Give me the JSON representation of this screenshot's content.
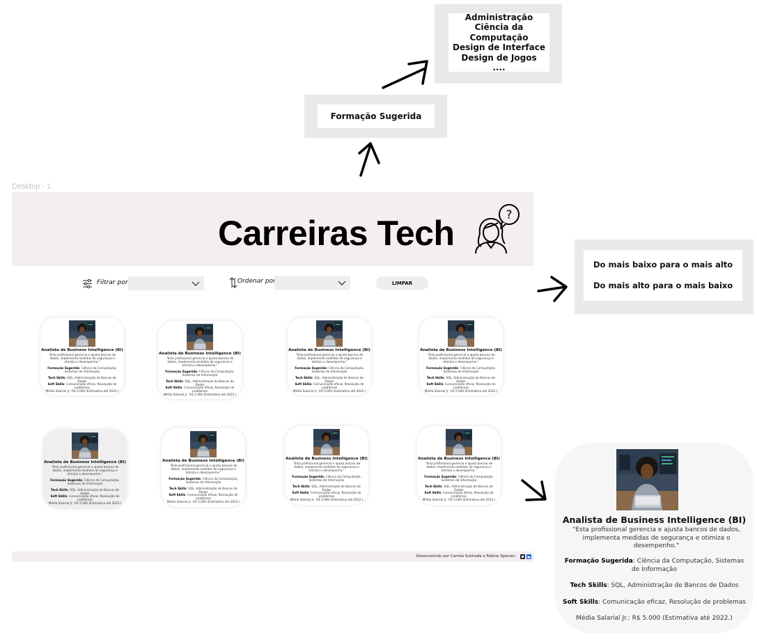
{
  "annotations": {
    "courses_lines": [
      "Administração",
      "Ciência da Computação",
      "Design de Interface",
      "Design de Jogos",
      "...."
    ],
    "formacao_label": "Formação Sugerida",
    "order_options": [
      "Do mais baixo para o mais alto",
      "Do mais alto para o mais baixo"
    ]
  },
  "frame_label": "Desktop - 1",
  "header": {
    "title": "Carreiras Tech"
  },
  "toolbar": {
    "filter_label": "Filtrar por:",
    "filter_value": "",
    "order_label": "Ordenar por:",
    "order_value": "",
    "clear_label": "LIMPAR"
  },
  "card_template": {
    "title": "Analista de Business Intelligence (BI)",
    "description": "\"Esta profissional gerencia e ajusta bancos de dados, implementa medidas de segurança e otimiza o desempenho.\"",
    "formacao_key": "Formação Sugerida",
    "formacao_value": "Ciência da Computação, Sistemas de Informação",
    "tech_key": "Tech Skills",
    "tech_value": "SQL, Administração de Bancos de Dados",
    "soft_key": "Soft Skills",
    "soft_value": "Comunicação eficaz, Resolução de problemas",
    "salary": "Média Salarial Jr.: R$ 5.000 (Estimativa até 2022.)"
  },
  "footer": {
    "text": "Desenvolvido por Camila Sukhada e Fabine Specian"
  },
  "colors": {
    "header_bg": "#f4eef3",
    "annotation_bg": "#e9e9e9",
    "card_bg": "#ffffff",
    "select_bg": "#eeeeee"
  },
  "icons": [
    "filter-sliders-icon",
    "sort-arrows-icon",
    "chevron-down-icon",
    "person-question-icon",
    "github-icon",
    "linkedin-icon"
  ]
}
